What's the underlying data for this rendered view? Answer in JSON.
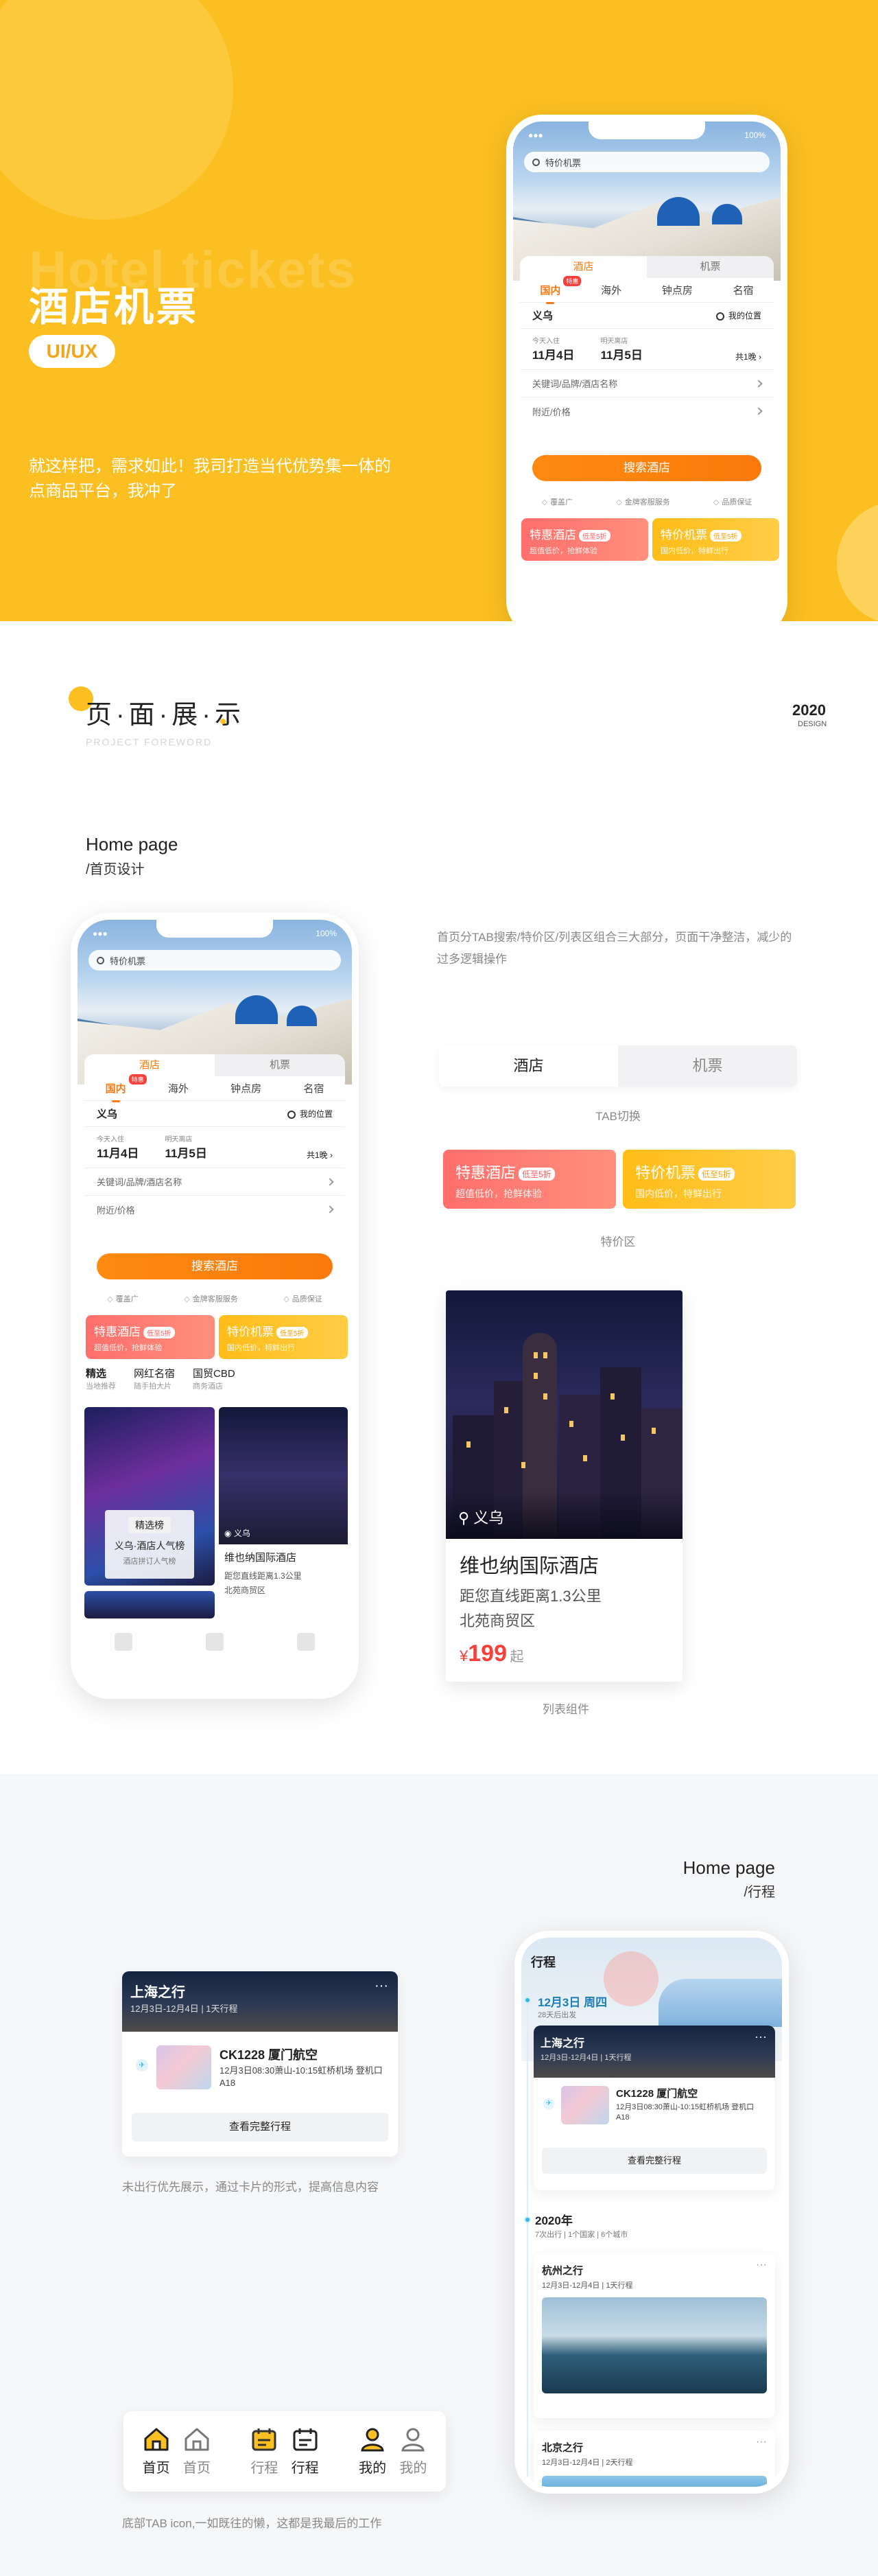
{
  "hero": {
    "ghost": "Hotel tickets",
    "title": "酒店机票",
    "tag": "UI/UX",
    "desc": "就这样把，需求如此！我司打造当代优势集一体的点商品平台，我冲了"
  },
  "phone": {
    "status_right": "100%",
    "search_placeholder": "特价机票",
    "tabs": [
      "酒店",
      "机票"
    ],
    "subtabs": [
      "国内",
      "海外",
      "钟点房",
      "名宿"
    ],
    "subtab_badge": "特惠",
    "city": "义乌",
    "my_location": "我的位置",
    "checkin_label": "今天入住",
    "checkout_label": "明天离店",
    "checkin_date": "11月4日",
    "checkout_date": "11月5日",
    "nights": "共1晚",
    "keyword_placeholder": "关键词/品牌/酒店名称",
    "nearby": "附近/价格",
    "search_btn": "搜索酒店",
    "features": [
      "覆盖广",
      "金牌客服服务",
      "品质保证"
    ],
    "promo_hotel": {
      "title": "特惠酒店",
      "pill": "低至5折",
      "sub": "超值低价，抢鲜体验"
    },
    "promo_flight": {
      "title": "特价机票",
      "pill": "低至5折",
      "sub": "国内低价，特鲜出行"
    },
    "list_tabs": [
      {
        "title": "精选",
        "sub": "当地推荐"
      },
      {
        "title": "网红名宿",
        "sub": "随手拍大片"
      },
      {
        "title": "国贸CBD",
        "sub": "商务酒店"
      }
    ],
    "rank_badge": "精选榜",
    "rank_title": "义乌·酒店人气榜",
    "rank_sub": "酒店拼订人气榜",
    "mini_hotel_loc": "义乌",
    "mini_hotel_name": "维也纳国际酒店",
    "mini_hotel_dist": "距您直线距离1.3公里",
    "mini_hotel_area": "北苑商贸区"
  },
  "section": {
    "title": "页·面·展·示",
    "sub": "PROJECT FOREWORD",
    "year": "2020",
    "year_sub": "DESIGN"
  },
  "home": {
    "en": "Home page",
    "cn": "/首页设计",
    "desc": "首页分TAB搜索/特价区/列表区组合三大部分，页面干净整洁，减少的过多逻辑操作",
    "tab_demo": [
      "酒店",
      "机票"
    ],
    "tab_caption": "TAB切换",
    "special_caption": "特价区",
    "list_caption": "列表组件"
  },
  "list_card": {
    "loc": "义乌",
    "name": "维也纳国际酒店",
    "dist": "距您直线距离1.3公里",
    "area": "北苑商贸区",
    "price": "199",
    "currency": "¥",
    "price_suffix": "起"
  },
  "trip": {
    "en": "Home page",
    "cn": "/行程",
    "card_title": "上海之行",
    "card_dates": "12月3日-12月4日 | 1天行程",
    "flight_no": "CK1228 厦门航空",
    "flight_detail": "12月3日08:30萧山-10:15虹桥机场 登机口A18",
    "view_full": "查看完整行程",
    "card_caption": "未出行优先展示，通过卡片的形式，提高信息内容",
    "phone_header": "行程",
    "date_heading": "12月3日 周四",
    "date_sub": "28天后出发",
    "year_heading": "2020年",
    "year_sub": "7次出行 | 1个国家 | 6个城市",
    "hz_title": "杭州之行",
    "hz_dates": "12月3日-12月4日 | 1天行程",
    "bj_title": "北京之行",
    "bj_dates": "12月3日-12月4日 | 2天行程",
    "tabbar": [
      "首页",
      "首页",
      "行程",
      "行程",
      "我的",
      "我的"
    ],
    "tabbar_caption": "底部TAB icon,一如既往的懒，这都是我最后的工作"
  },
  "colors": {
    "brand": "#fbbf21",
    "accent": "#f97a0b",
    "hot": "#f7403a",
    "timeline": "#33b5e5"
  }
}
